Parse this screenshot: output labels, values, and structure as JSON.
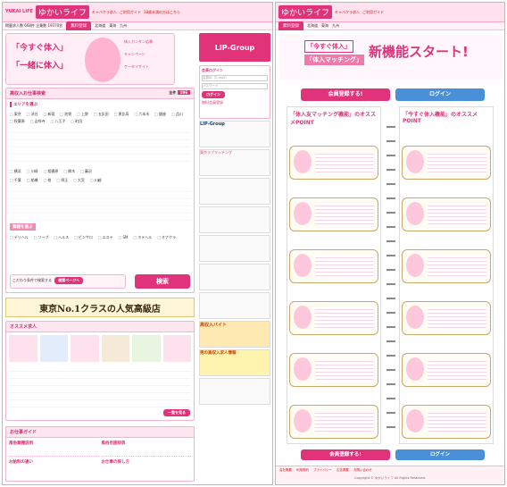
{
  "site": {
    "logo_en": "YUKAI LIFE",
    "logo_jp": "ゆかいライフ",
    "tagline": "高収入・風俗求人サイト",
    "nav": {
      "tab": "無料登録",
      "links": [
        "北海道",
        "東海",
        "九州"
      ],
      "sub_links": [
        "キャバクラ求人",
        "ご利用ガイド",
        "18歳未満の方はこちら"
      ]
    },
    "stats": "掲載求人数 668件 企業数 19370名"
  },
  "left": {
    "banner": {
      "line1": "「今すぐ体入」",
      "line2": "「一緒に体入」",
      "side1": "体入カンタン応募",
      "side2": "キャンペーン",
      "side3": "ケータイサイト",
      "promo": "LIP-Group"
    },
    "search": {
      "title": "高収入お仕事検索",
      "count_label": "全件",
      "count": "196",
      "area_title": "エリアを選ぶ",
      "areas": [
        "東京",
        "渋谷",
        "新宿",
        "池袋",
        "上野",
        "五反田",
        "恵比寿",
        "六本木",
        "銀座",
        "品川",
        "秋葉原",
        "吉祥寺",
        "八王子",
        "町田"
      ],
      "kanagawa": [
        "横浜",
        "川崎",
        "相模原",
        "厚木",
        "藤沢"
      ],
      "others": [
        "千葉",
        "船橋",
        "柏",
        "埼玉",
        "大宮",
        "川越"
      ],
      "job_title": "業種を選ぶ",
      "jobs": [
        "デリヘル",
        "ソープ",
        "ヘルス",
        "ピンサロ",
        "エステ",
        "SM",
        "ホテヘル",
        "オナクラ"
      ],
      "search_btn": "検索",
      "sub_search": "こだわり条件で検索する",
      "sub_btn": "検索ページへ"
    },
    "ad": "東京No.1クラスの人気高級店",
    "recommend": {
      "title": "オススメ求人",
      "more": "一覧を見る"
    },
    "guide": {
      "title": "お仕事ガイド",
      "item1": "風俗業種説明",
      "item2": "風俗用語辞典",
      "item3": "お給料の違い",
      "item4": "お仕事の探し方"
    },
    "login": {
      "label": "会員ログイン",
      "id": "会員ID（E-mail）",
      "pass": "パスワード",
      "btn": "ログイン",
      "register": "無料会員登録"
    },
    "side_ads": [
      "LIP-Group",
      "東京ラブマッチング",
      "高収入バイト",
      "男の高収入求人情報"
    ]
  },
  "right": {
    "title": "新機能スタート!",
    "left_tag": "「今すぐ体入」",
    "right_tag": "「体入マッチング」",
    "register_btn": "会員登録する!",
    "login_btn": "ログイン",
    "col1": "「体入友マッチング機能」のオススメPOINT",
    "col2": "「今すぐ体入機能」のオススメPOINT",
    "footer_links": [
      "会社概要",
      "利用規約",
      "プライバシー",
      "広告掲載",
      "お問い合わせ"
    ],
    "copyright": "Copyright © ゆかいライフ All Rights Reserved."
  }
}
